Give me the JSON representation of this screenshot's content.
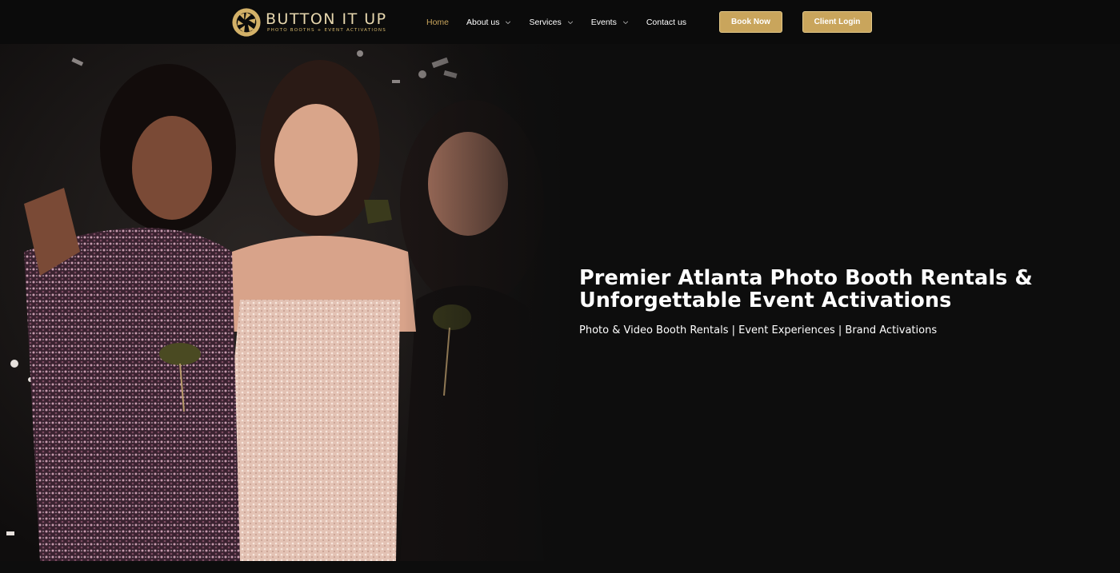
{
  "brand": {
    "name": "BUTTON IT UP",
    "tagline": "PHOTO BOOTHS + EVENT ACTIVATIONS",
    "colors": {
      "gold": "#c9a55c",
      "logo_text": "#e7d7ae",
      "background": "#0d0d0d"
    }
  },
  "nav": {
    "items": [
      {
        "label": "Home",
        "active": true,
        "has_dropdown": false
      },
      {
        "label": "About us",
        "active": false,
        "has_dropdown": true
      },
      {
        "label": "Services",
        "active": false,
        "has_dropdown": true
      },
      {
        "label": "Events",
        "active": false,
        "has_dropdown": true
      },
      {
        "label": "Contact us",
        "active": false,
        "has_dropdown": false
      }
    ],
    "dropdown_icon": "chevron-down-icon"
  },
  "actions": {
    "book_now": "Book Now",
    "client_login": "Client Login"
  },
  "hero": {
    "title": "Premier Atlanta Photo Booth Rentals & Unforgettable Event Activations",
    "subtitle": "Photo & Video Booth Rentals | Event Experiences | Brand Activations"
  }
}
